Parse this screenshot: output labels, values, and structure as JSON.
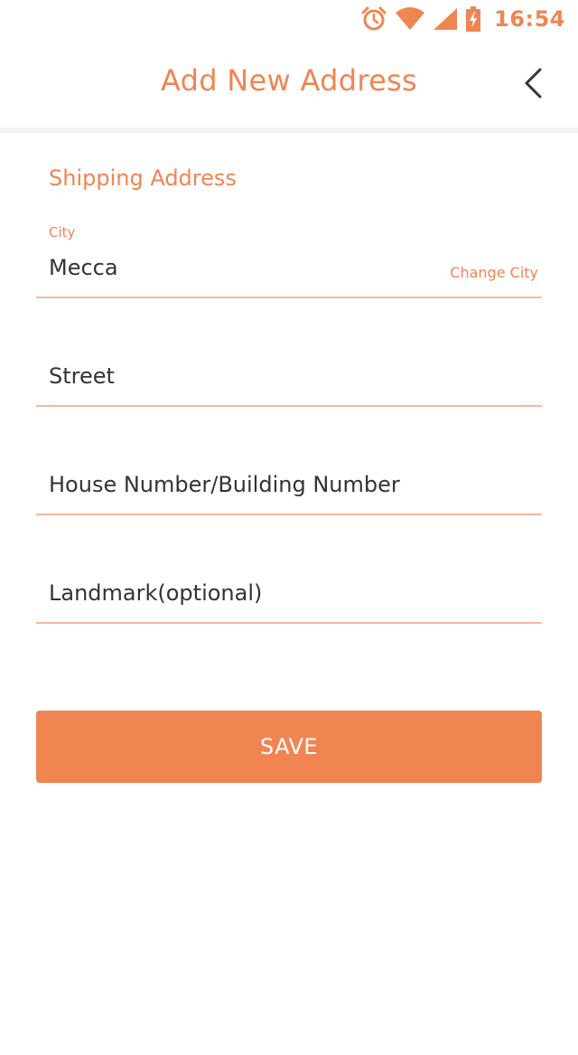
{
  "status_bar": {
    "time": "16:54",
    "icons": [
      "alarm-icon",
      "wifi-icon",
      "signal-icon",
      "battery-charging-icon"
    ],
    "color": "#f08552"
  },
  "app_bar": {
    "title": "Add New Address",
    "back_icon": "chevron-left-icon"
  },
  "form": {
    "section_title": "Shipping Address",
    "city": {
      "label": "City",
      "value": "Mecca",
      "change_label": "Change City"
    },
    "street": {
      "placeholder": "Street"
    },
    "house_number": {
      "placeholder": "House Number/Building Number"
    },
    "landmark": {
      "placeholder": "Landmark(optional)"
    }
  },
  "save_button": {
    "label": "SAVE"
  },
  "colors": {
    "accent": "#f08552",
    "field_underline": "#f5b89a",
    "text": "#333333",
    "background": "#ffffff"
  }
}
